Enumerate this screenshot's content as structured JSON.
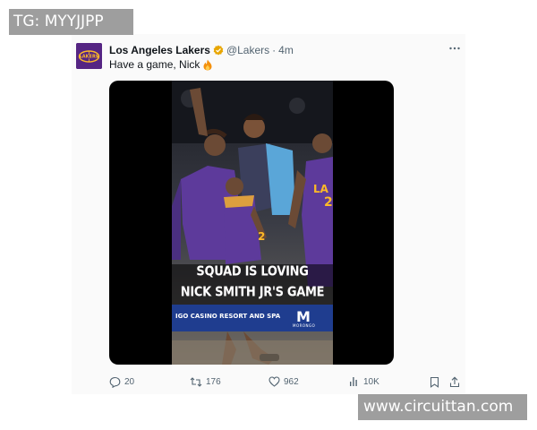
{
  "watermarks": {
    "top": "TG: MYYJJPP",
    "bottom": "www.circuittan.com"
  },
  "tweet": {
    "display_name": "Los Angeles Lakers",
    "handle": "@Lakers",
    "separator": "·",
    "time": "4m",
    "text": "Have a game, Nick",
    "text_emoji_icon": "fire-icon",
    "verified_icon": "verified-badge-icon",
    "avatar_icon": "lakers-logo-icon",
    "more_icon": "more-options-icon",
    "media": {
      "caption_line1": "SQUAD IS LOVING",
      "caption_line2": "NICK SMITH JR'S GAME",
      "sponsor_text": "IGO CASINO RESORT AND SPA",
      "sponsor_logo_letter": "M",
      "sponsor_logo_sub": "MORONGO"
    },
    "actions": {
      "reply_count": "20",
      "retweet_count": "176",
      "like_count": "962",
      "view_count": "10K"
    }
  },
  "colors": {
    "lakers_purple": "#552583",
    "lakers_gold": "#FDB927",
    "text_primary": "#0f1419",
    "text_secondary": "#536471",
    "sponsor_blue": "#1f3d8f"
  }
}
